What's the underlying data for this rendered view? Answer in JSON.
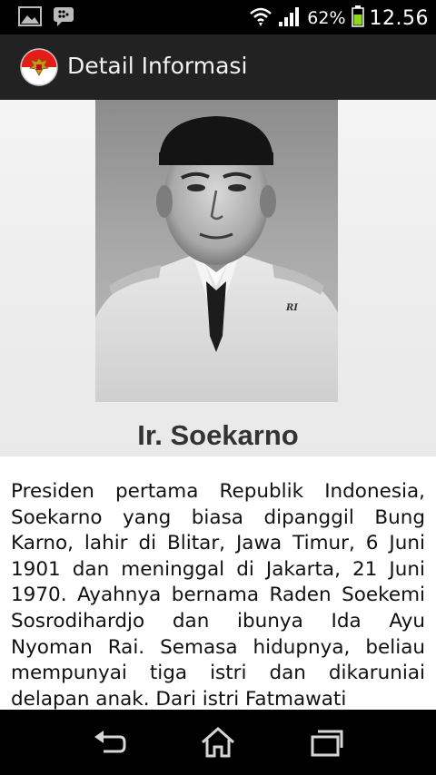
{
  "status_bar": {
    "battery_percent": "62%",
    "time": "12.56",
    "icons": [
      "gallery-icon",
      "bbm-icon",
      "wifi-icon",
      "signal-icon",
      "battery-icon"
    ]
  },
  "action_bar": {
    "title": "Detail Informasi",
    "logo": "garuda-logo"
  },
  "detail": {
    "name": "Ir. Soekarno",
    "description": "Presiden pertama Republik Indonesia, Soekarno yang biasa dipanggil Bung Karno, lahir di Blitar, Jawa Timur, 6 Juni 1901 dan meninggal di Jakarta, 21 Juni 1970. Ayahnya bernama Raden Soekemi Sosrodihardjo dan ibunya Ida Ayu Nyoman Rai. Semasa hidupnya, beliau mempunyai tiga istri dan dikaruniai delapan anak. Dari istri Fatmawati"
  },
  "nav_bar": {
    "buttons": [
      "back-icon",
      "home-icon",
      "recents-icon"
    ]
  }
}
